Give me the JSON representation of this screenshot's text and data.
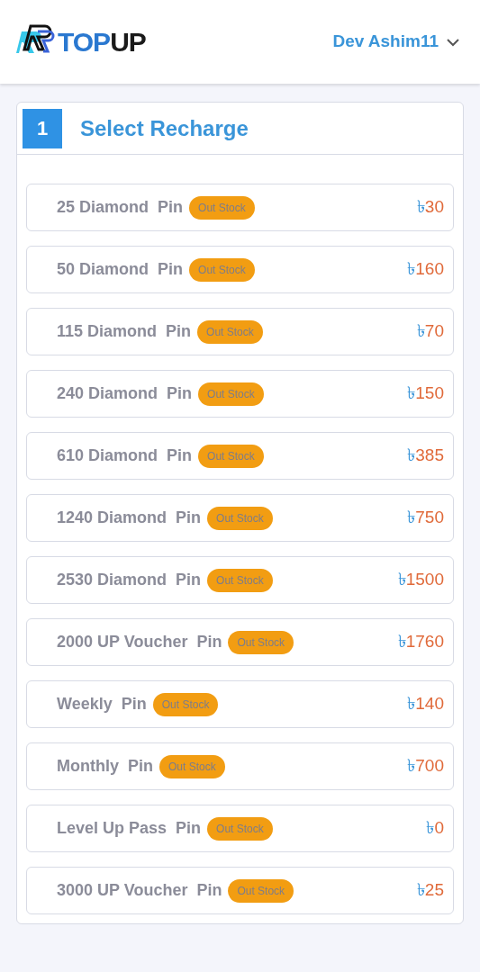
{
  "header": {
    "logo": {
      "part_1": "TOP",
      "part_2": "UP"
    },
    "user": "Dev Ashim11"
  },
  "section": {
    "step": "1",
    "title": "Select Recharge"
  },
  "items": [
    {
      "name": "25 Diamond",
      "suffix": "Pin",
      "badge": "Out Stock",
      "currency": "৳",
      "price": "30"
    },
    {
      "name": "50 Diamond",
      "suffix": "Pin",
      "badge": "Out Stock",
      "currency": "৳",
      "price": "160"
    },
    {
      "name": "115 Diamond",
      "suffix": "Pin",
      "badge": "Out Stock",
      "currency": "৳",
      "price": "70"
    },
    {
      "name": "240 Diamond",
      "suffix": "Pin",
      "badge": "Out Stock",
      "currency": "৳",
      "price": "150"
    },
    {
      "name": "610 Diamond",
      "suffix": "Pin",
      "badge": "Out Stock",
      "currency": "৳",
      "price": "385"
    },
    {
      "name": "1240 Diamond",
      "suffix": "Pin",
      "badge": "Out Stock",
      "currency": "৳",
      "price": "750"
    },
    {
      "name": "2530 Diamond",
      "suffix": "Pin",
      "badge": "Out Stock",
      "currency": "৳",
      "price": "1500"
    },
    {
      "name": "2000 UP Voucher",
      "suffix": "Pin",
      "badge": "Out Stock",
      "currency": "৳",
      "price": "1760"
    },
    {
      "name": "Weekly",
      "suffix": "Pin",
      "badge": "Out Stock",
      "currency": "৳",
      "price": "140"
    },
    {
      "name": "Monthly",
      "suffix": "Pin",
      "badge": "Out Stock",
      "currency": "৳",
      "price": "700"
    },
    {
      "name": "Level Up Pass",
      "suffix": "Pin",
      "badge": "Out Stock",
      "currency": "৳",
      "price": "0"
    },
    {
      "name": "3000 UP Voucher",
      "suffix": "Pin",
      "badge": "Out Stock",
      "currency": "৳",
      "price": "25"
    }
  ]
}
